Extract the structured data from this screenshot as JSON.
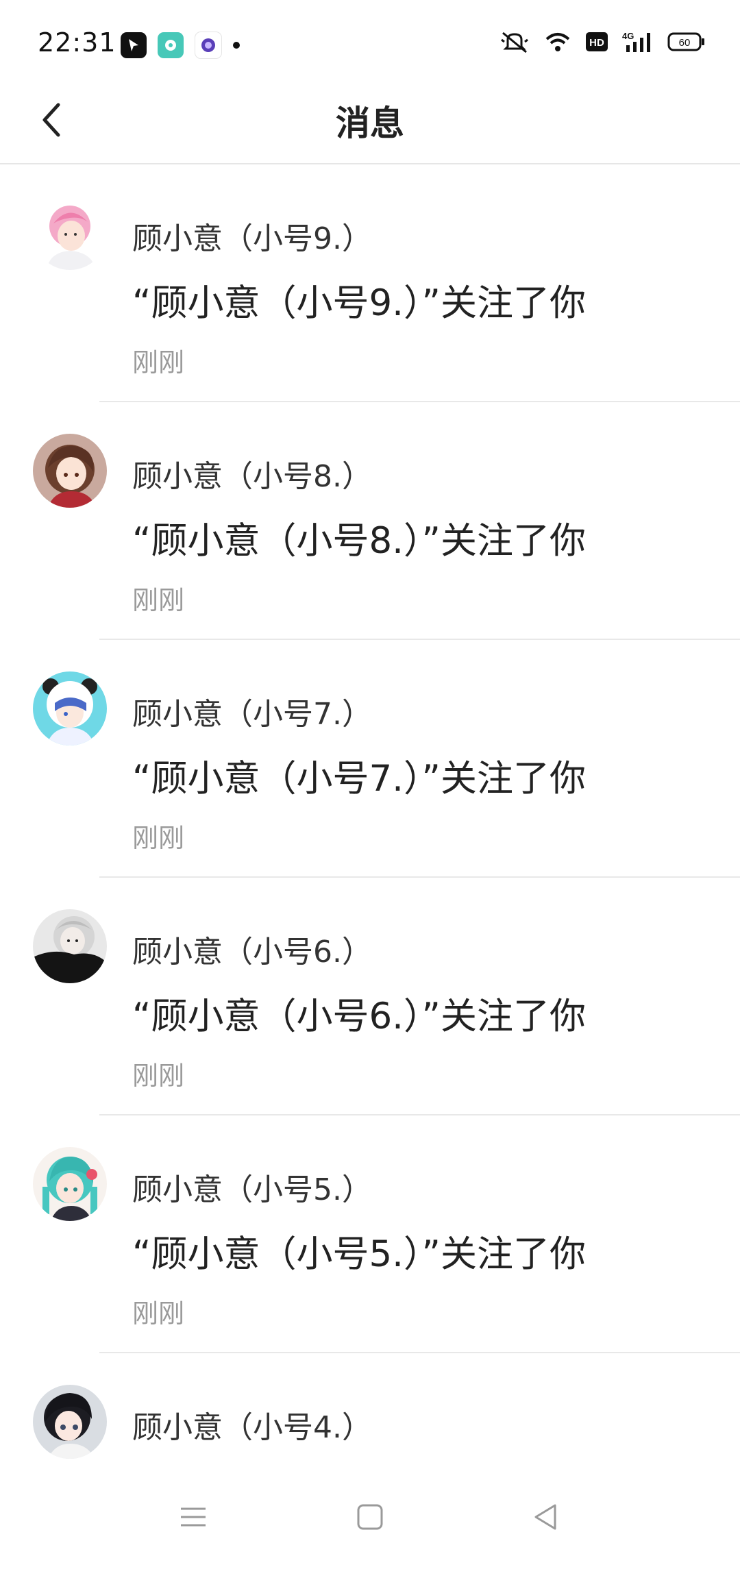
{
  "status_bar": {
    "time": "22:31",
    "battery": "60",
    "network": "4G",
    "hd": "HD"
  },
  "header": {
    "title": "消息",
    "back_icon": "chevron-left-icon"
  },
  "messages": [
    {
      "name": "顾小意（小号9.）",
      "text": "“顾小意（小号9.）”关注了你",
      "time": "刚刚"
    },
    {
      "name": "顾小意（小号8.）",
      "text": "“顾小意（小号8.）”关注了你",
      "time": "刚刚"
    },
    {
      "name": "顾小意（小号7.）",
      "text": "“顾小意（小号7.）”关注了你",
      "time": "刚刚"
    },
    {
      "name": "顾小意（小号6.）",
      "text": "“顾小意（小号6.）”关注了你",
      "time": "刚刚"
    },
    {
      "name": "顾小意（小号5.）",
      "text": "“顾小意（小号5.）”关注了你",
      "time": "刚刚"
    },
    {
      "name": "顾小意（小号4.）"
    }
  ],
  "nav_bar": {
    "icons": [
      "menu-icon",
      "home-square-icon",
      "back-triangle-icon"
    ]
  },
  "colors": {
    "divider": "#e8e8e8",
    "time_text": "#9a9a9a"
  }
}
